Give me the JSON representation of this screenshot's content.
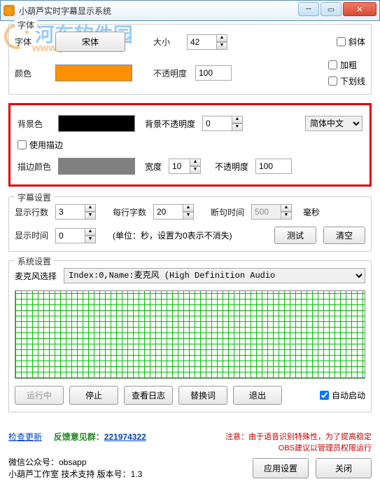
{
  "window": {
    "title": "小葫芦实时字幕显示系统"
  },
  "watermark": {
    "text": "河东软件园",
    "url": "www.pc0359.cn"
  },
  "font_group": {
    "label": "字体",
    "font_label": "字体",
    "font_button": "宋体",
    "size_label": "大小",
    "size_value": "42",
    "color_label": "颜色",
    "opacity_label": "不透明度",
    "opacity_value": "100",
    "italic": "斜体",
    "bold": "加粗",
    "underline": "下划线"
  },
  "bg": {
    "bgcolor_label": "背景色",
    "bgopacity_label": "背景不透明度",
    "bgopacity_value": "0",
    "lang_select": "简体中文",
    "stroke_chk": "使用描边",
    "stroke_color_label": "描边颜色",
    "width_label": "宽度",
    "width_value": "10",
    "opacity_label": "不透明度",
    "opacity_value": "100"
  },
  "subtitle": {
    "label": "字幕设置",
    "lines_label": "显示行数",
    "lines_value": "3",
    "chars_label": "每行字数",
    "chars_value": "20",
    "gap_label": "断句时间",
    "gap_value": "500",
    "gap_unit": "毫秒",
    "duration_label": "显示时间",
    "duration_value": "0",
    "duration_note": "(单位：秒，设置为0表示不消失)",
    "test_btn": "测试",
    "clear_btn": "清空"
  },
  "sys": {
    "label": "系统设置",
    "mic_label": "麦克风选择",
    "mic_value": "Index:0,Name:麦克风 (High Definition Audio",
    "running": "运行中",
    "stop": "停止",
    "log": "查看日志",
    "replace": "替换词",
    "exit": "退出",
    "autostart": "自动启动"
  },
  "footer": {
    "check_update": "检查更新",
    "feedback_label": "反馈意见群：",
    "feedback_qq": "221974322",
    "wechat": "微信公众号：obsapp",
    "studio": "小葫芦工作室 技术支持 版本号：1.3",
    "note1": "注意：由于语音识别特殊性，为了提高稳定",
    "note2": "OBS建议以管理员权限运行",
    "apply_btn": "应用设置",
    "close_btn": "关闭"
  }
}
